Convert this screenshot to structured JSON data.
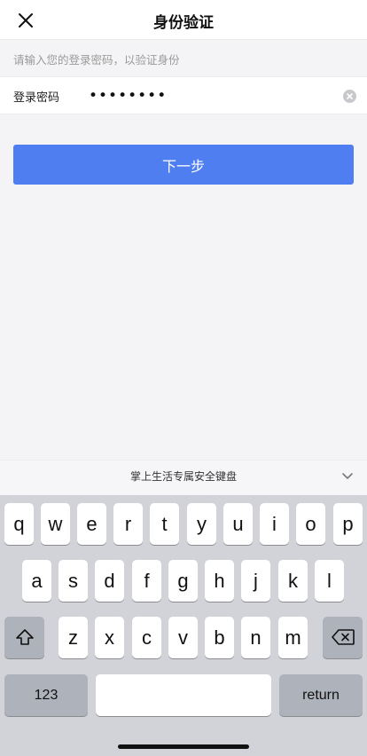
{
  "header": {
    "title": "身份验证"
  },
  "hint": "请输入您的登录密码，以验证身份",
  "password": {
    "label": "登录密码",
    "value": "••••••••"
  },
  "next_label": "下一步",
  "keyboard": {
    "title": "掌上生活专属安全键盘",
    "row1": [
      "q",
      "w",
      "e",
      "r",
      "t",
      "y",
      "u",
      "i",
      "o",
      "p"
    ],
    "row2": [
      "a",
      "s",
      "d",
      "f",
      "g",
      "h",
      "j",
      "k",
      "l"
    ],
    "row3": [
      "z",
      "x",
      "c",
      "v",
      "b",
      "n",
      "m"
    ],
    "numbers_label": "123",
    "return_label": "return"
  }
}
